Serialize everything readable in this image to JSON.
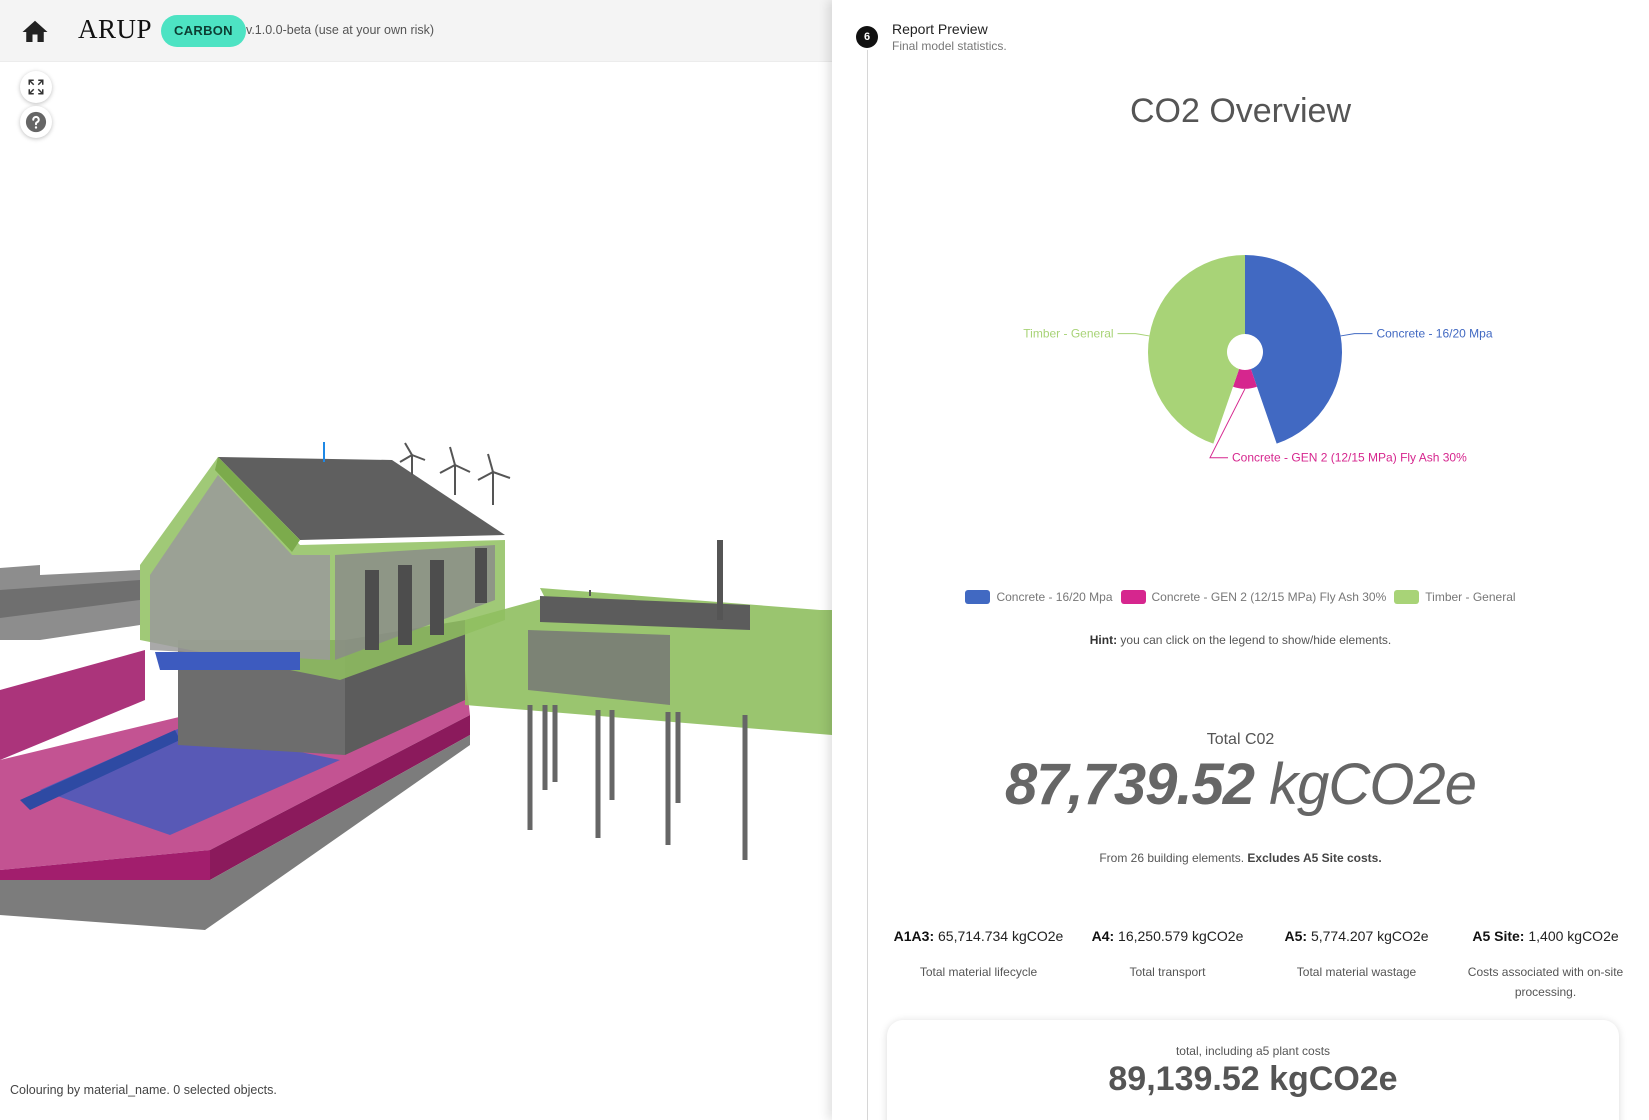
{
  "header": {
    "logo": "ARUP",
    "badge": "CARBON",
    "version": "v.1.0.0-beta (use at your own risk)"
  },
  "icons": {
    "home": "home-icon",
    "fullscreen": "fullscreen-icon",
    "help": "help-icon"
  },
  "viewer": {
    "status": "Colouring by material_name. 0 selected objects."
  },
  "report": {
    "step_number": "6",
    "step_title": "Report Preview",
    "step_subtitle": "Final model statistics.",
    "hint_bold": "Hint:",
    "hint_text": " you can click on the legend to show/hide elements.",
    "total_label": "Total C02",
    "total_number": "87,739.52",
    "total_unit": " kgCO2e",
    "elements_note": "From 26 building elements. ",
    "elements_note_bold": "Excludes A5 Site costs.",
    "stats": [
      {
        "key": "A1A3:",
        "value": " 65,714.734 kgCO2e",
        "desc": "Total material lifecycle"
      },
      {
        "key": "A4:",
        "value": " 16,250.579 kgCO2e",
        "desc": "Total transport"
      },
      {
        "key": "A5:",
        "value": " 5,774.207 kgCO2e",
        "desc": "Total material wastage"
      },
      {
        "key": "A5 Site:",
        "value": " 1,400 kgCO2e",
        "desc": "Costs associated with on-site processing."
      }
    ],
    "summary_label": "total, including a5 plant costs",
    "summary_value": "89,139.52 kgCO2e"
  },
  "colors": {
    "concrete_16_20": "#4169c2",
    "concrete_gen2": "#d6268e",
    "timber": "#a8d377",
    "badge": "#4de3c3"
  },
  "chart_data": {
    "type": "pie",
    "title": "CO2 Overview",
    "categories": [
      "Concrete - 16/20 Mpa",
      "Concrete - GEN 2 (12/15 MPa) Fly Ash 30%",
      "Timber - General"
    ],
    "series": [
      {
        "values": [
          38,
          9,
          38
        ]
      }
    ],
    "legend": "bottom",
    "colors": [
      "#4169c2",
      "#d6268e",
      "#a8d377"
    ]
  }
}
